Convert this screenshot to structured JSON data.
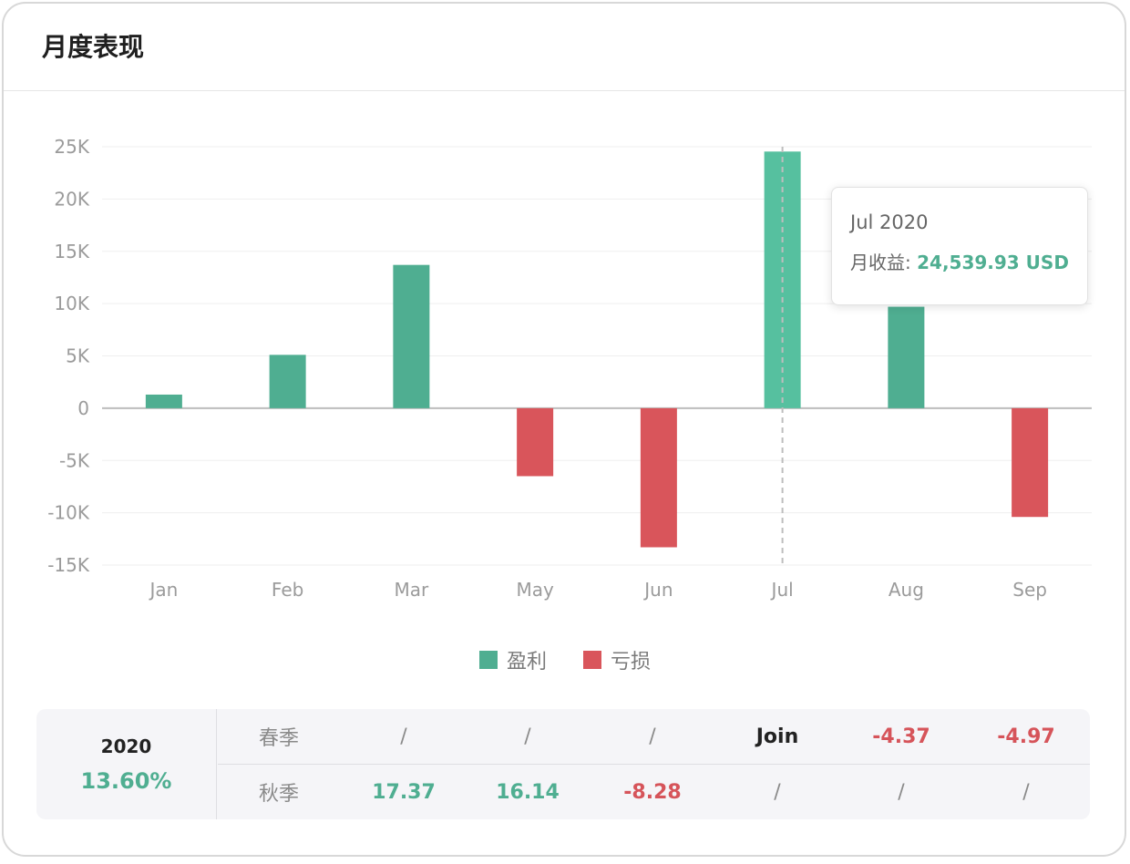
{
  "header": {
    "title": "月度表现"
  },
  "colors": {
    "profit": "#4fae91",
    "loss": "#d9555b",
    "highlight": "#56c09f"
  },
  "chart_data": {
    "type": "bar",
    "title": "",
    "xlabel": "",
    "ylabel": "",
    "categories": [
      "Jan",
      "Feb",
      "Mar",
      "May",
      "Jun",
      "Jul",
      "Aug",
      "Sep"
    ],
    "values": [
      1300,
      5100,
      13700,
      -6500,
      -13300,
      24539.93,
      9700,
      -10400
    ],
    "ylim": [
      -15000,
      25000
    ],
    "yticks": [
      25000,
      20000,
      15000,
      10000,
      5000,
      0,
      -5000,
      -10000,
      -15000
    ],
    "ytick_labels": [
      "25K",
      "20K",
      "15K",
      "10K",
      "5K",
      "0",
      "-5K",
      "-10K",
      "-15K"
    ],
    "grid": true,
    "legend": {
      "position": "bottom-center",
      "entries": [
        "盈利",
        "亏损"
      ]
    },
    "highlighted_category": "Jul"
  },
  "tooltip": {
    "title": "Jul 2020",
    "label": "月收益: ",
    "value": "24,539.93 USD"
  },
  "summary": {
    "year": "2020",
    "year_return": "13.60%",
    "rows": [
      {
        "label": "春季",
        "cells": [
          "/",
          "/",
          "/",
          "Join",
          "-4.37",
          "-4.97"
        ]
      },
      {
        "label": "秋季",
        "cells": [
          "17.37",
          "16.14",
          "-8.28",
          "/",
          "/",
          "/"
        ]
      }
    ]
  }
}
